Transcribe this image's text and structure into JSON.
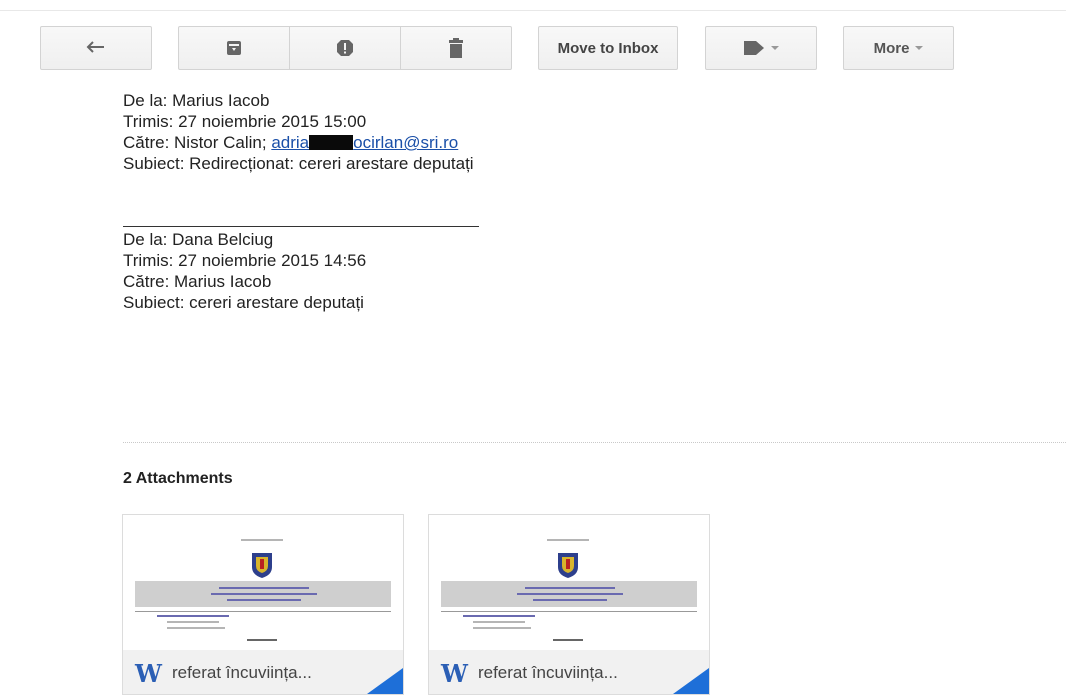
{
  "toolbar": {
    "move_label": "Move to Inbox",
    "more_label": "More"
  },
  "header1": {
    "from": "De la: Marius Iacob",
    "sent": "Trimis: 27 noiembrie 2015 15:00",
    "to_prefix": "Către: Nistor Calin; ",
    "to_link_start": "adria",
    "to_link_end": "ocirlan@sri.ro",
    "subject": "Subiect: Redirecționat: cereri arestare deputați"
  },
  "header2": {
    "from": "De la: Dana Belciug",
    "sent": "Trimis: 27 noiembrie 2015 14:56",
    "to": "Către: Marius Iacob",
    "subject": "Subiect: cereri arestare deputați"
  },
  "attachments": {
    "title": "2 Attachments",
    "items": [
      {
        "name": "referat încuviința..."
      },
      {
        "name": "referat încuviința..."
      }
    ]
  },
  "colors": {
    "link": "#1a4fa8",
    "word_icon": "#2b5fb5",
    "corner": "#1e6fd8"
  }
}
